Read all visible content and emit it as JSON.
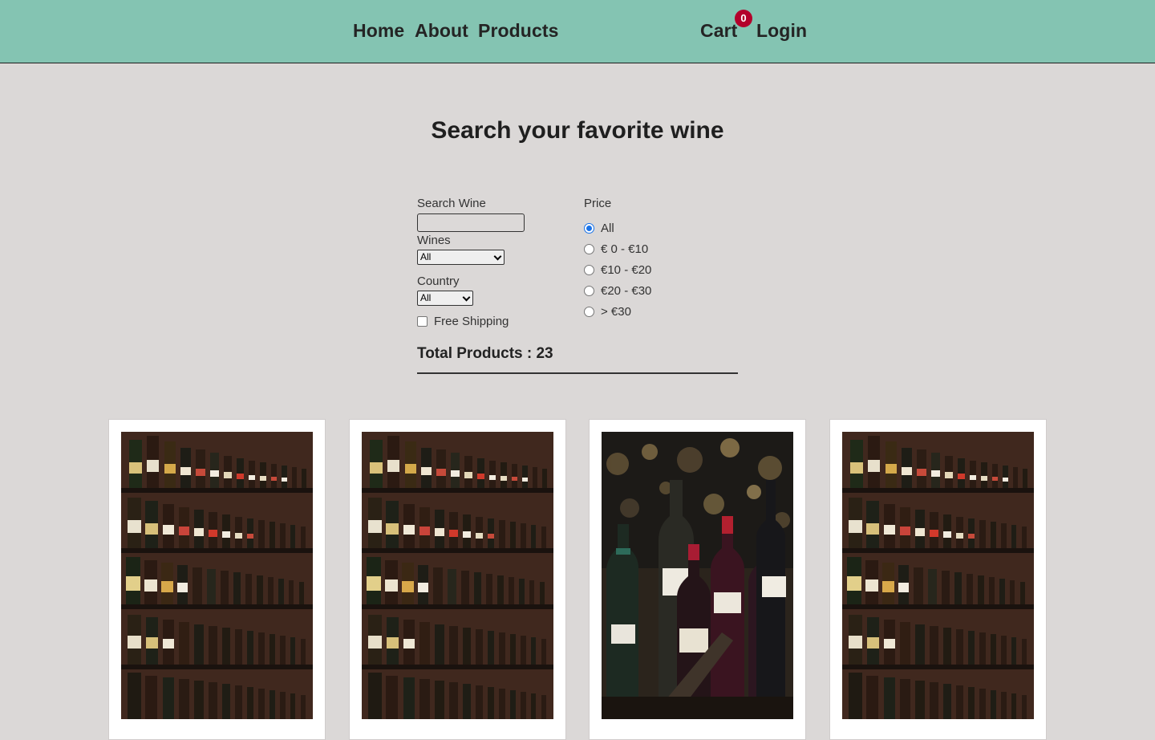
{
  "nav": {
    "home": "Home",
    "about": "About",
    "products": "Products",
    "cart": "Cart",
    "cart_count": "0",
    "login": "Login"
  },
  "page_title": "Search your favorite wine",
  "filters": {
    "search_label": "Search Wine",
    "search_value": "",
    "wines_label": "Wines",
    "wines_selected": "All",
    "country_label": "Country",
    "country_selected": "All",
    "free_shipping_label": "Free Shipping",
    "free_shipping_checked": false,
    "price_label": "Price",
    "price_options": [
      "All",
      "€ 0 - €10",
      "€10 - €20",
      "€20 - €30",
      "> €30"
    ],
    "price_selected": "All"
  },
  "total_products": "Total Products : 23",
  "products": [
    {
      "image": "wine-shelves-photo"
    },
    {
      "image": "wine-shelves-photo"
    },
    {
      "image": "wine-bottles-closeup-photo"
    },
    {
      "image": "wine-shelves-photo"
    }
  ],
  "colors": {
    "navbar": "#84c4b2",
    "background": "#dbd8d7",
    "badge": "#b3002b",
    "radio_accent": "#1a73e8"
  }
}
